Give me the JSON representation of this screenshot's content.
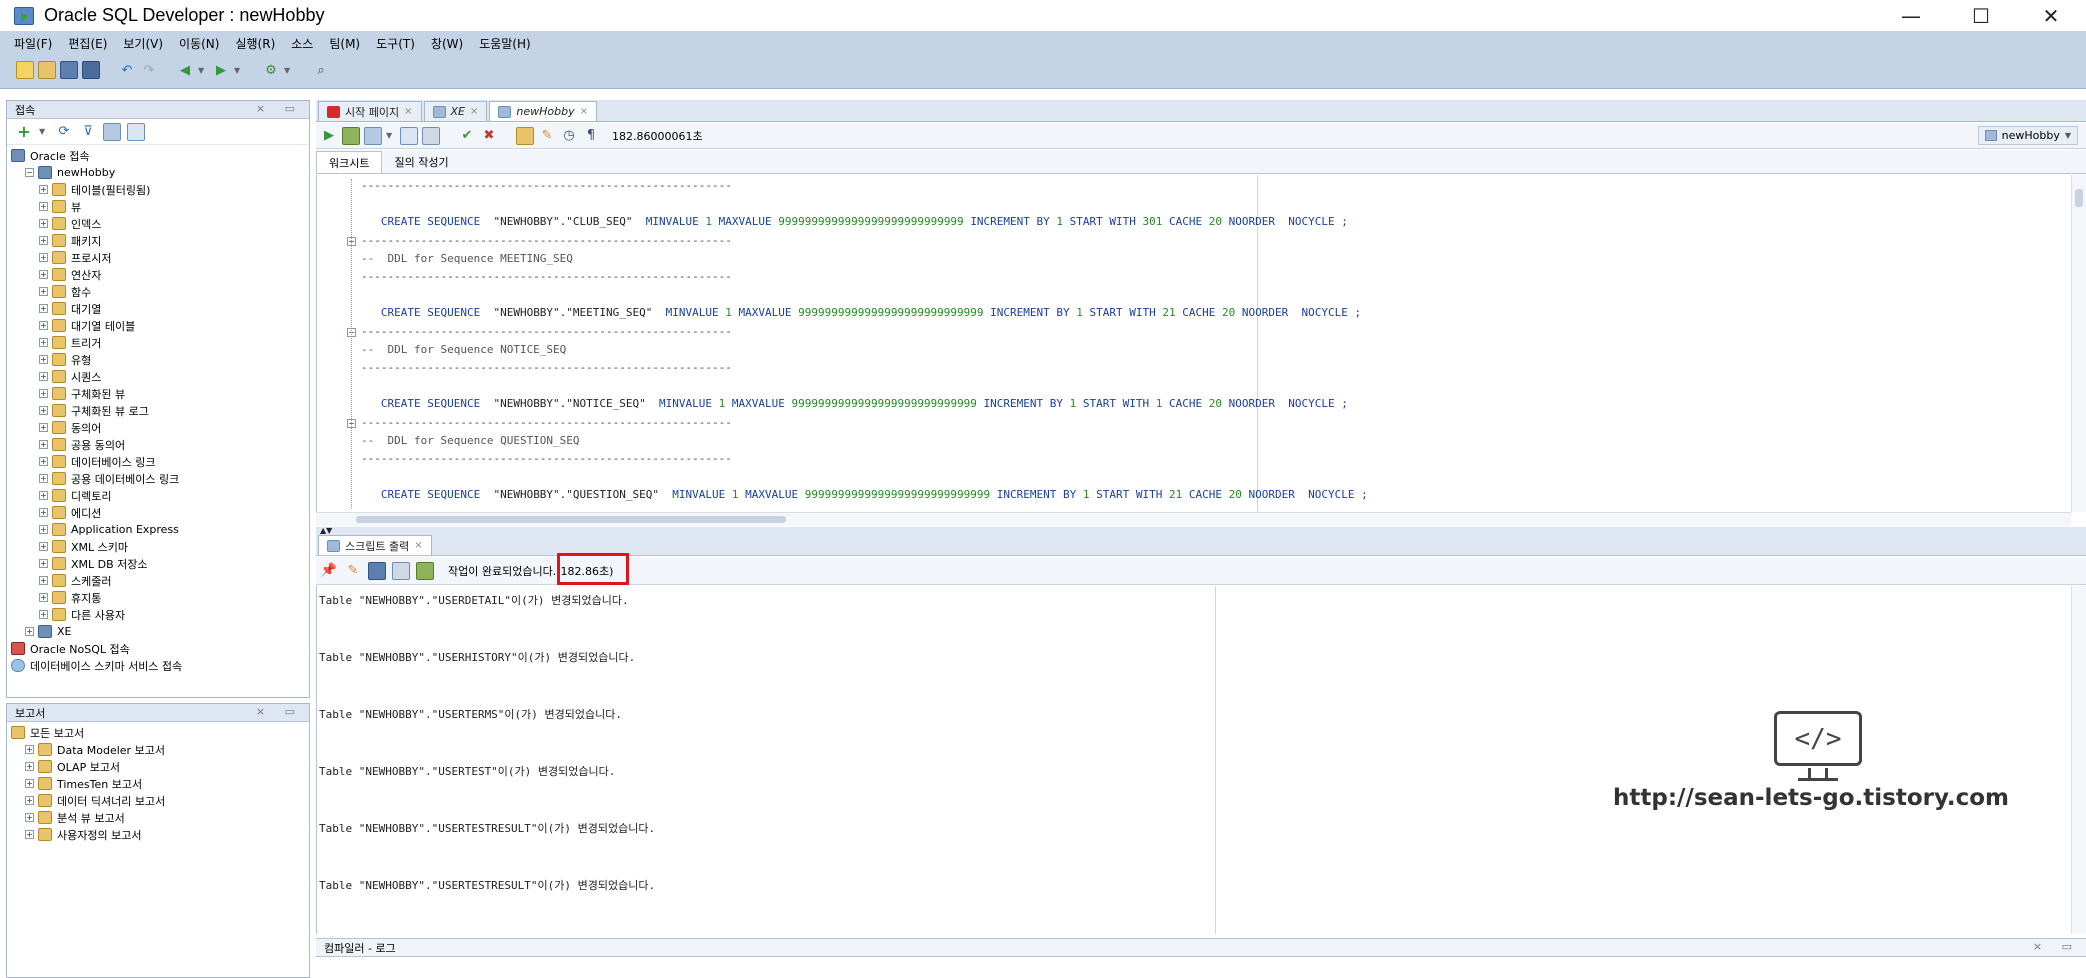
{
  "window": {
    "title": "Oracle SQL Developer : newHobby",
    "minimize": "—",
    "maximize": "☐",
    "close": "✕"
  },
  "menu": [
    "파일(F)",
    "편집(E)",
    "보기(V)",
    "이동(N)",
    "실행(R)",
    "소스",
    "팀(M)",
    "도구(T)",
    "창(W)",
    "도움말(H)"
  ],
  "connections_panel": {
    "title": "접속",
    "tree": [
      {
        "label": "Oracle 접속",
        "level": 0,
        "icon": "db"
      },
      {
        "label": "newHobby",
        "level": 1,
        "icon": "db",
        "expanded": true
      },
      {
        "label": "테이블(필터링됨)",
        "level": 2,
        "icon": "folder"
      },
      {
        "label": "뷰",
        "level": 2,
        "icon": "folder"
      },
      {
        "label": "인덱스",
        "level": 2,
        "icon": "folder"
      },
      {
        "label": "패키지",
        "level": 2,
        "icon": "folder"
      },
      {
        "label": "프로시저",
        "level": 2,
        "icon": "folder"
      },
      {
        "label": "연산자",
        "level": 2,
        "icon": "folder"
      },
      {
        "label": "함수",
        "level": 2,
        "icon": "folder"
      },
      {
        "label": "대기열",
        "level": 2,
        "icon": "folder"
      },
      {
        "label": "대기열 테이블",
        "level": 2,
        "icon": "folder"
      },
      {
        "label": "트리거",
        "level": 2,
        "icon": "folder"
      },
      {
        "label": "유형",
        "level": 2,
        "icon": "folder"
      },
      {
        "label": "시퀀스",
        "level": 2,
        "icon": "folder"
      },
      {
        "label": "구체화된 뷰",
        "level": 2,
        "icon": "folder"
      },
      {
        "label": "구체화된 뷰 로그",
        "level": 2,
        "icon": "folder"
      },
      {
        "label": "동의어",
        "level": 2,
        "icon": "folder"
      },
      {
        "label": "공용 동의어",
        "level": 2,
        "icon": "folder"
      },
      {
        "label": "데이터베이스 링크",
        "level": 2,
        "icon": "folder"
      },
      {
        "label": "공용 데이터베이스 링크",
        "level": 2,
        "icon": "folder"
      },
      {
        "label": "디렉토리",
        "level": 2,
        "icon": "folder"
      },
      {
        "label": "에디션",
        "level": 2,
        "icon": "folder"
      },
      {
        "label": "Application Express",
        "level": 2,
        "icon": "folder"
      },
      {
        "label": "XML 스키마",
        "level": 2,
        "icon": "folder"
      },
      {
        "label": "XML DB 저장소",
        "level": 2,
        "icon": "folder"
      },
      {
        "label": "스케줄러",
        "level": 2,
        "icon": "folder"
      },
      {
        "label": "휴지통",
        "level": 2,
        "icon": "folder"
      },
      {
        "label": "다른 사용자",
        "level": 2,
        "icon": "folder"
      },
      {
        "label": "XE",
        "level": 1,
        "icon": "db"
      },
      {
        "label": "Oracle NoSQL 접속",
        "level": 0,
        "icon": "red"
      },
      {
        "label": "데이터베이스 스키마 서비스 접속",
        "level": 0,
        "icon": "cloud"
      }
    ]
  },
  "reports_panel": {
    "title": "보고서",
    "tree": [
      {
        "label": "모든 보고서",
        "level": 0
      },
      {
        "label": "Data Modeler 보고서",
        "level": 1
      },
      {
        "label": "OLAP 보고서",
        "level": 1
      },
      {
        "label": "TimesTen 보고서",
        "level": 1
      },
      {
        "label": "데이터 딕셔너리 보고서",
        "level": 1
      },
      {
        "label": "분석 뷰 보고서",
        "level": 1
      },
      {
        "label": "사용자정의 보고서",
        "level": 1
      }
    ]
  },
  "editor": {
    "tabs": [
      {
        "label": "시작 페이지",
        "active": false
      },
      {
        "label": "XE",
        "active": false
      },
      {
        "label": "newHobby",
        "active": true
      }
    ],
    "exec_time": "182.86000061초",
    "connection": "newHobby",
    "sheet_tabs": [
      "워크시트",
      "질의 작성기"
    ],
    "code": [
      {
        "type": "rule",
        "text": "--------------------------------------------------------"
      },
      {
        "type": "blank",
        "text": ""
      },
      {
        "type": "stmt",
        "parts": [
          {
            "c": "kw",
            "t": "   CREATE SEQUENCE  "
          },
          {
            "c": "str",
            "t": "\"NEWHOBBY\".\"CLUB_SEQ\"  "
          },
          {
            "c": "kw",
            "t": "MINVALUE "
          },
          {
            "c": "num",
            "t": "1 "
          },
          {
            "c": "kw",
            "t": "MAXVALUE "
          },
          {
            "c": "num",
            "t": "9999999999999999999999999999 "
          },
          {
            "c": "kw",
            "t": "INCREMENT BY "
          },
          {
            "c": "num",
            "t": "1 "
          },
          {
            "c": "kw",
            "t": "START WITH "
          },
          {
            "c": "num",
            "t": "301 "
          },
          {
            "c": "kw",
            "t": "CACHE "
          },
          {
            "c": "num",
            "t": "20 "
          },
          {
            "c": "kw",
            "t": "NOORDER  NOCYCLE ;"
          }
        ]
      },
      {
        "type": "rule",
        "text": "--------------------------------------------------------"
      },
      {
        "type": "comment",
        "text": "--  DDL for Sequence MEETING_SEQ"
      },
      {
        "type": "rule",
        "text": "--------------------------------------------------------"
      },
      {
        "type": "blank",
        "text": ""
      },
      {
        "type": "stmt",
        "parts": [
          {
            "c": "kw",
            "t": "   CREATE SEQUENCE  "
          },
          {
            "c": "str",
            "t": "\"NEWHOBBY\".\"MEETING_SEQ\"  "
          },
          {
            "c": "kw",
            "t": "MINVALUE "
          },
          {
            "c": "num",
            "t": "1 "
          },
          {
            "c": "kw",
            "t": "MAXVALUE "
          },
          {
            "c": "num",
            "t": "9999999999999999999999999999 "
          },
          {
            "c": "kw",
            "t": "INCREMENT BY "
          },
          {
            "c": "num",
            "t": "1 "
          },
          {
            "c": "kw",
            "t": "START WITH "
          },
          {
            "c": "num",
            "t": "21 "
          },
          {
            "c": "kw",
            "t": "CACHE "
          },
          {
            "c": "num",
            "t": "20 "
          },
          {
            "c": "kw",
            "t": "NOORDER  NOCYCLE ;"
          }
        ]
      },
      {
        "type": "rule",
        "text": "--------------------------------------------------------"
      },
      {
        "type": "comment",
        "text": "--  DDL for Sequence NOTICE_SEQ"
      },
      {
        "type": "rule",
        "text": "--------------------------------------------------------"
      },
      {
        "type": "blank",
        "text": ""
      },
      {
        "type": "stmt",
        "parts": [
          {
            "c": "kw",
            "t": "   CREATE SEQUENCE  "
          },
          {
            "c": "str",
            "t": "\"NEWHOBBY\".\"NOTICE_SEQ\"  "
          },
          {
            "c": "kw",
            "t": "MINVALUE "
          },
          {
            "c": "num",
            "t": "1 "
          },
          {
            "c": "kw",
            "t": "MAXVALUE "
          },
          {
            "c": "num",
            "t": "9999999999999999999999999999 "
          },
          {
            "c": "kw",
            "t": "INCREMENT BY "
          },
          {
            "c": "num",
            "t": "1 "
          },
          {
            "c": "kw",
            "t": "START WITH "
          },
          {
            "c": "num",
            "t": "1 "
          },
          {
            "c": "kw",
            "t": "CACHE "
          },
          {
            "c": "num",
            "t": "20 "
          },
          {
            "c": "kw",
            "t": "NOORDER  NOCYCLE ;"
          }
        ]
      },
      {
        "type": "rule",
        "text": "--------------------------------------------------------"
      },
      {
        "type": "comment",
        "text": "--  DDL for Sequence QUESTION_SEQ"
      },
      {
        "type": "rule",
        "text": "--------------------------------------------------------"
      },
      {
        "type": "blank",
        "text": ""
      },
      {
        "type": "stmt",
        "parts": [
          {
            "c": "kw",
            "t": "   CREATE SEQUENCE  "
          },
          {
            "c": "str",
            "t": "\"NEWHOBBY\".\"QUESTION_SEQ\"  "
          },
          {
            "c": "kw",
            "t": "MINVALUE "
          },
          {
            "c": "num",
            "t": "1 "
          },
          {
            "c": "kw",
            "t": "MAXVALUE "
          },
          {
            "c": "num",
            "t": "9999999999999999999999999999 "
          },
          {
            "c": "kw",
            "t": "INCREMENT BY "
          },
          {
            "c": "num",
            "t": "1 "
          },
          {
            "c": "kw",
            "t": "START WITH "
          },
          {
            "c": "num",
            "t": "21 "
          },
          {
            "c": "kw",
            "t": "CACHE "
          },
          {
            "c": "num",
            "t": "20 "
          },
          {
            "c": "kw",
            "t": "NOORDER  NOCYCLE ;"
          }
        ]
      }
    ]
  },
  "output": {
    "tab_label": "스크립트 출력",
    "status_text": "작업이 완료되었습니다.",
    "status_time": "(182.86초)",
    "lines": [
      "Table \"NEWHOBBY\".\"USERDETAIL\"이(가) 변경되었습니다.",
      "Table \"NEWHOBBY\".\"USERHISTORY\"이(가) 변경되었습니다.",
      "Table \"NEWHOBBY\".\"USERTERMS\"이(가) 변경되었습니다.",
      "Table \"NEWHOBBY\".\"USERTEST\"이(가) 변경되었습니다.",
      "Table \"NEWHOBBY\".\"USERTESTRESULT\"이(가) 변경되었습니다.",
      "Table \"NEWHOBBY\".\"USERTESTRESULT\"이(가) 변경되었습니다."
    ]
  },
  "watermark": {
    "glyph": "</>",
    "url": "http://sean-lets-go.tistory.com"
  },
  "compiler_log": {
    "title": "컴파일러 - 로그"
  },
  "colors": {
    "chrome": "#c4d3e6",
    "keyword": "#1a3f9c",
    "number": "#228b22",
    "highlight_box": "#e0141e"
  }
}
